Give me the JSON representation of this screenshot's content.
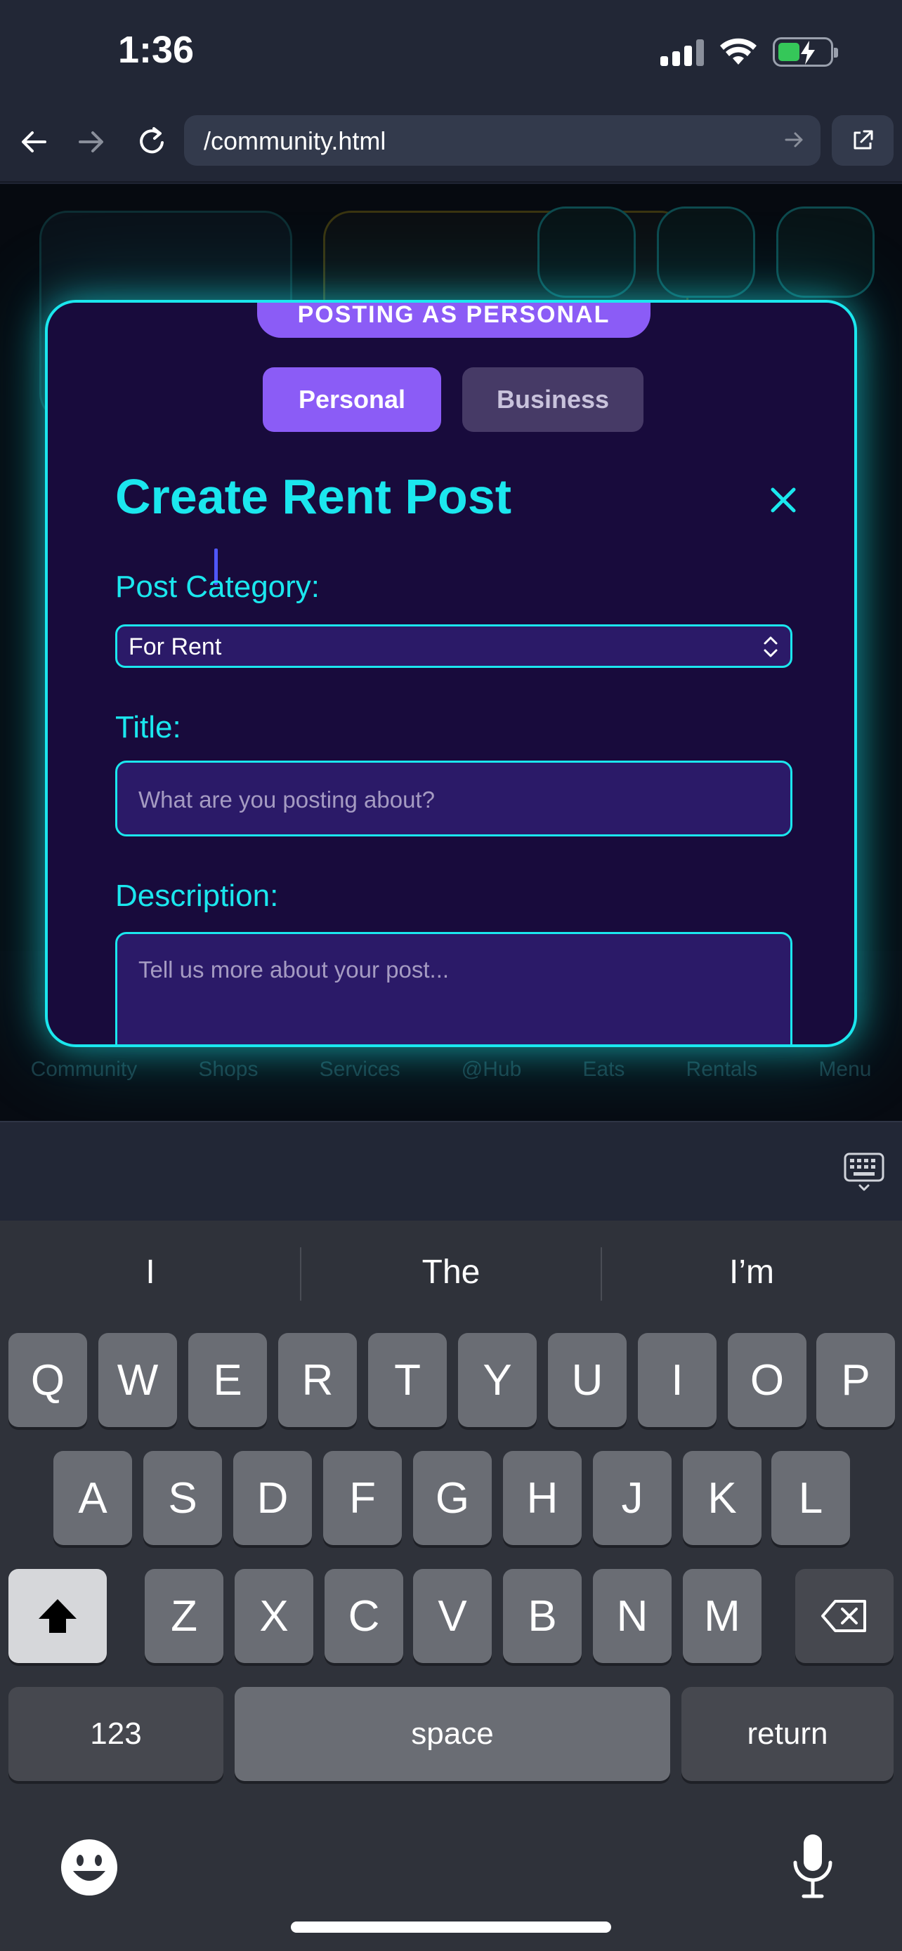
{
  "status_bar": {
    "time": "1:36",
    "icons": [
      "cellular-signal-icon",
      "wifi-icon",
      "battery-charging-icon"
    ]
  },
  "browser": {
    "url": "/community.html",
    "icons": [
      "back-arrow-icon",
      "forward-arrow-icon",
      "reload-icon",
      "go-arrow-icon",
      "open-external-icon"
    ]
  },
  "background_nav": {
    "items": [
      "Community",
      "Shops",
      "Services",
      "@Hub",
      "Eats",
      "Rentals",
      "Menu"
    ]
  },
  "modal": {
    "badge": "POSTING AS PERSONAL",
    "toggle_personal": "Personal",
    "toggle_business": "Business",
    "title": "Create Rent Post",
    "category_label": "Post Category:",
    "category_value": "For Rent",
    "title_label": "Title:",
    "title_placeholder": "What are you posting about?",
    "description_label": "Description:",
    "description_placeholder": "Tell us more about your post..."
  },
  "colors": {
    "accent_cyan": "#1be7ee",
    "accent_purple": "#8b5cf6",
    "modal_bg": "#180b3c",
    "input_bg": "#2b1a68"
  },
  "keyboard": {
    "suggestions": [
      "I",
      "The",
      "I’m"
    ],
    "row1": [
      "Q",
      "W",
      "E",
      "R",
      "T",
      "Y",
      "U",
      "I",
      "O",
      "P"
    ],
    "row2": [
      "A",
      "S",
      "D",
      "F",
      "G",
      "H",
      "J",
      "K",
      "L"
    ],
    "row3": [
      "Z",
      "X",
      "C",
      "V",
      "B",
      "N",
      "M"
    ],
    "numbers_key": "123",
    "space_key": "space",
    "return_key": "return"
  }
}
